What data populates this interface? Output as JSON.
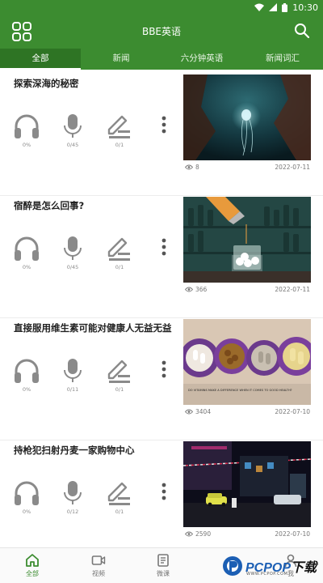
{
  "status": {
    "time": "10:30"
  },
  "app": {
    "title": "BBE英语"
  },
  "tabs": [
    {
      "label": "全部"
    },
    {
      "label": "新闻"
    },
    {
      "label": "六分钟英语"
    },
    {
      "label": "新闻词汇"
    }
  ],
  "articles": [
    {
      "title": "探索深海的秘密",
      "listen": "0%",
      "record": "0/45",
      "write": "0/1",
      "views": "8",
      "date": "2022-07-11",
      "thumb": "jellyfish-photo"
    },
    {
      "title": "宿醉是怎么回事?",
      "listen": "0%",
      "record": "0/45",
      "write": "0/1",
      "views": "366",
      "date": "2022-07-11",
      "thumb": "hangover-bar-photo"
    },
    {
      "title": "直接服用维生素可能对健康人无益无益",
      "listen": "0%",
      "record": "0/11",
      "write": "0/1",
      "views": "3404",
      "date": "2022-07-10",
      "thumb": "vitamin-pills-photo",
      "thumb_caption": "DO VITAMINS MAKE A DIFFERENCE WHEN IT COMES TO GOOD HEALTH?"
    },
    {
      "title": "持枪犯扫射丹麦一家购物中心",
      "listen": "0%",
      "record": "0/12",
      "write": "0/1",
      "views": "2590",
      "date": "2022-07-10",
      "thumb": "shopping-centre-night-photo"
    }
  ],
  "bottom_nav": [
    {
      "label": "全部",
      "icon": "home-icon",
      "active": true
    },
    {
      "label": "视频",
      "icon": "video-icon",
      "active": false
    },
    {
      "label": "微课",
      "icon": "micro-lesson-icon",
      "active": false
    },
    {
      "label": "我",
      "icon": "person-icon",
      "active": false
    }
  ],
  "watermark": {
    "brand": "PCPOP",
    "suffix": "下载",
    "url": "WWW.PCPOP.COM"
  },
  "colors": {
    "brand_green": "#3c8c30",
    "icon_gray": "#8a8a8a",
    "watermark_blue": "#1c5fb4"
  }
}
